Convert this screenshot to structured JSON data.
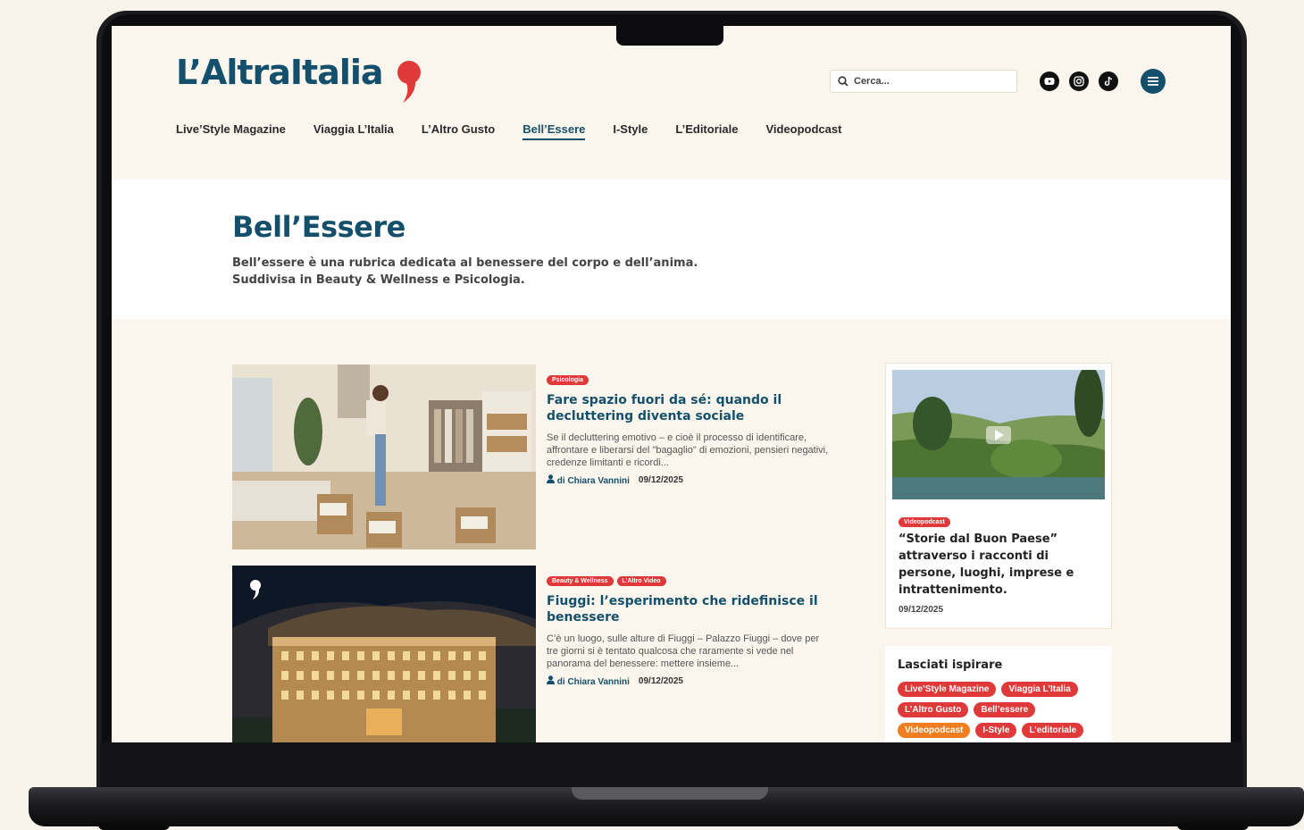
{
  "brand": {
    "logo_text": "L’AltraItalia",
    "accent_color": "#14506b",
    "tag_color": "#e0393a",
    "highlight_color": "#f07d1f"
  },
  "search": {
    "placeholder": "Cerca..."
  },
  "social_icons": [
    "youtube-icon",
    "instagram-icon",
    "tiktok-icon"
  ],
  "nav": {
    "items": [
      {
        "label": "Live’Style Magazine"
      },
      {
        "label": "Viaggia L’Italia"
      },
      {
        "label": "L’Altro Gusto"
      },
      {
        "label": "Bell’Essere",
        "active": true
      },
      {
        "label": "I-Style"
      },
      {
        "label": "L’Editoriale"
      },
      {
        "label": "Videopodcast"
      }
    ]
  },
  "hero": {
    "title": "Bell’Essere",
    "desc_line1": "Bell’essere è una rubrica dedicata al benessere del corpo e dell’anima.",
    "desc_line2": "Suddivisa in Beauty & Wellness e Psicologia."
  },
  "articles": [
    {
      "tags": [
        "Psicologia"
      ],
      "title": "Fare spazio fuori da sé: quando il decluttering diventa sociale",
      "excerpt": "Se il decluttering emotivo – e cioè il processo di identificare, affrontare e liberarsi del \"bagaglio\" di emozioni, pensieri negativi, credenze limitanti e ricordi...",
      "author": "di Chiara Vannini",
      "date": "09/12/2025"
    },
    {
      "tags": [
        "Beauty & Wellness",
        "L’Altro Video"
      ],
      "title": "Fiuggi: l’esperimento che ridefinisce il benessere",
      "excerpt": "C’è un luogo, sulle alture di Fiuggi – Palazzo Fiuggi – dove per tre giorni si è tentato qualcosa che raramente si vede nel panorama del benessere: mettere insieme...",
      "author": "di Chiara Vannini",
      "date": "09/12/2025"
    }
  ],
  "sidebar": {
    "video": {
      "tag": "Videopodcast",
      "title": "“Storie dal Buon Paese” attraverso i racconti di persone, luoghi, imprese e intrattenimento.",
      "date": "09/12/2025"
    },
    "inspire": {
      "title": "Lasciati ispirare",
      "chips": [
        {
          "label": "Live’Style Magazine"
        },
        {
          "label": "Viaggia L’Italia"
        },
        {
          "label": "L’Altro Gusto"
        },
        {
          "label": "Bell’essere"
        },
        {
          "label": "Videopodcast",
          "highlight": true
        },
        {
          "label": "I-Style"
        },
        {
          "label": "L’editoriale"
        }
      ]
    }
  }
}
